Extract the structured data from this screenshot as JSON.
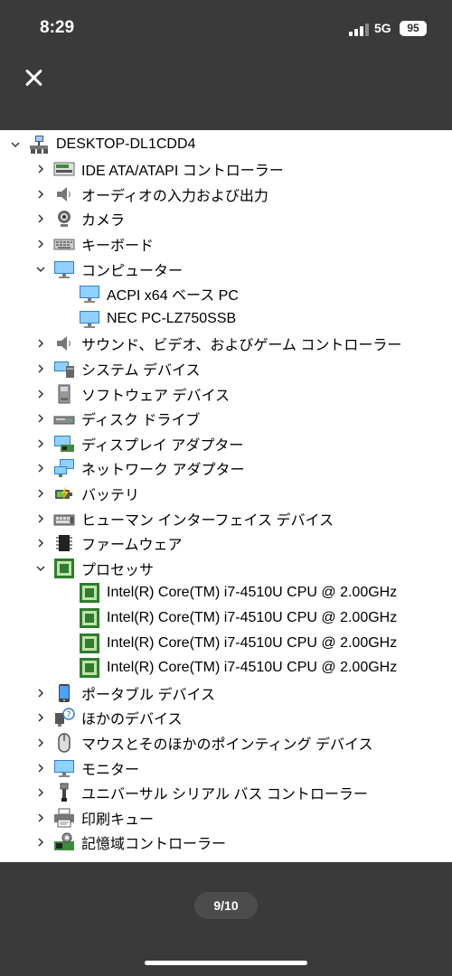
{
  "status_bar": {
    "time": "8:29",
    "network": "5G",
    "battery": "95"
  },
  "viewer": {
    "page_indicator": "9/10"
  },
  "device_tree": {
    "rows": [
      {
        "label": "DESKTOP-DL1CDD4",
        "icon": "computer-root-icon",
        "expander": "expanded",
        "level": 0
      },
      {
        "label": "IDE ATA/ATAPI コントローラー",
        "icon": "ide-controller-icon",
        "expander": "collapsed",
        "level": 1
      },
      {
        "label": "オーディオの入力および出力",
        "icon": "speaker-icon",
        "expander": "collapsed",
        "level": 1
      },
      {
        "label": "カメラ",
        "icon": "camera-icon",
        "expander": "collapsed",
        "level": 1
      },
      {
        "label": "キーボード",
        "icon": "keyboard-icon",
        "expander": "collapsed",
        "level": 1
      },
      {
        "label": "コンピューター",
        "icon": "monitor-icon",
        "expander": "expanded",
        "level": 1
      },
      {
        "label": "ACPI x64 ベース PC",
        "icon": "monitor-icon",
        "expander": "none",
        "level": 2
      },
      {
        "label": "NEC PC-LZ750SSB",
        "icon": "monitor-icon",
        "expander": "none",
        "level": 2
      },
      {
        "label": "サウンド、ビデオ、およびゲーム コントローラー",
        "icon": "speaker-icon",
        "expander": "collapsed",
        "level": 1
      },
      {
        "label": "システム デバイス",
        "icon": "system-device-icon",
        "expander": "collapsed",
        "level": 1
      },
      {
        "label": "ソフトウェア デバイス",
        "icon": "software-device-icon",
        "expander": "collapsed",
        "level": 1
      },
      {
        "label": "ディスク ドライブ",
        "icon": "disk-drive-icon",
        "expander": "collapsed",
        "level": 1
      },
      {
        "label": "ディスプレイ アダプター",
        "icon": "display-adapter-icon",
        "expander": "collapsed",
        "level": 1
      },
      {
        "label": "ネットワーク アダプター",
        "icon": "network-adapter-icon",
        "expander": "collapsed",
        "level": 1
      },
      {
        "label": "バッテリ",
        "icon": "battery-icon",
        "expander": "collapsed",
        "level": 1
      },
      {
        "label": "ヒューマン インターフェイス デバイス",
        "icon": "hid-icon",
        "expander": "collapsed",
        "level": 1
      },
      {
        "label": "ファームウェア",
        "icon": "firmware-chip-icon",
        "expander": "collapsed",
        "level": 1
      },
      {
        "label": "プロセッサ",
        "icon": "processor-icon",
        "expander": "expanded",
        "level": 1
      },
      {
        "label": "Intel(R) Core(TM) i7-4510U CPU @ 2.00GHz",
        "icon": "processor-icon",
        "expander": "none",
        "level": 2
      },
      {
        "label": "Intel(R) Core(TM) i7-4510U CPU @ 2.00GHz",
        "icon": "processor-icon",
        "expander": "none",
        "level": 2
      },
      {
        "label": "Intel(R) Core(TM) i7-4510U CPU @ 2.00GHz",
        "icon": "processor-icon",
        "expander": "none",
        "level": 2
      },
      {
        "label": "Intel(R) Core(TM) i7-4510U CPU @ 2.00GHz",
        "icon": "processor-icon",
        "expander": "none",
        "level": 2
      },
      {
        "label": "ポータブル デバイス",
        "icon": "portable-device-icon",
        "expander": "collapsed",
        "level": 1
      },
      {
        "label": "ほかのデバイス",
        "icon": "unknown-device-icon",
        "expander": "collapsed",
        "level": 1
      },
      {
        "label": "マウスとそのほかのポインティング デバイス",
        "icon": "mouse-icon",
        "expander": "collapsed",
        "level": 1
      },
      {
        "label": "モニター",
        "icon": "monitor-icon",
        "expander": "collapsed",
        "level": 1
      },
      {
        "label": "ユニバーサル シリアル バス コントローラー",
        "icon": "usb-icon",
        "expander": "collapsed",
        "level": 1
      },
      {
        "label": "印刷キュー",
        "icon": "printer-icon",
        "expander": "collapsed",
        "level": 1
      },
      {
        "label": "記憶域コントローラー",
        "icon": "storage-controller-icon",
        "expander": "collapsed",
        "level": 1
      }
    ]
  }
}
